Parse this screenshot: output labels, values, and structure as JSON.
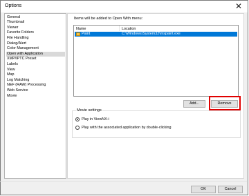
{
  "window": {
    "title": "Options",
    "close_glyph": "✕"
  },
  "sidebar": {
    "items": [
      {
        "label": "General"
      },
      {
        "label": "Thumbnail"
      },
      {
        "label": "Viewer"
      },
      {
        "label": "Favorite Folders"
      },
      {
        "label": "File Handling"
      },
      {
        "label": "Dialog/Alert"
      },
      {
        "label": "Color Management"
      },
      {
        "label": "Open with Application"
      },
      {
        "label": "XMP/IPTC Preset"
      },
      {
        "label": "Labels"
      },
      {
        "label": "View"
      },
      {
        "label": "Map"
      },
      {
        "label": "Log Matching"
      },
      {
        "label": "NEF (RAW) Processing"
      },
      {
        "label": "Web Service"
      },
      {
        "label": "Movie"
      }
    ],
    "selected_label": "Open with Application"
  },
  "main": {
    "intro_text": "Items will be added to Open With menu:",
    "list": {
      "columns": [
        "Name",
        "Location"
      ],
      "rows": [
        {
          "icon": "paint-app-icon",
          "name": "Paint",
          "location": "C:\\Windows\\System32\\mspaint.exe",
          "selected": true
        }
      ]
    },
    "buttons": {
      "add_label": "Add...",
      "remove_label": "Remove"
    },
    "movie_settings": {
      "title": "Movie settings",
      "options": [
        {
          "label": "Play in ViewNX-i",
          "checked": true
        },
        {
          "label": "Play with the associated application by double-clicking",
          "checked": false
        }
      ]
    }
  },
  "footer": {
    "ok_label": "OK",
    "cancel_label": "Cancel"
  },
  "colors": {
    "selection": "#0078d7",
    "highlight_box": "#e00000"
  }
}
